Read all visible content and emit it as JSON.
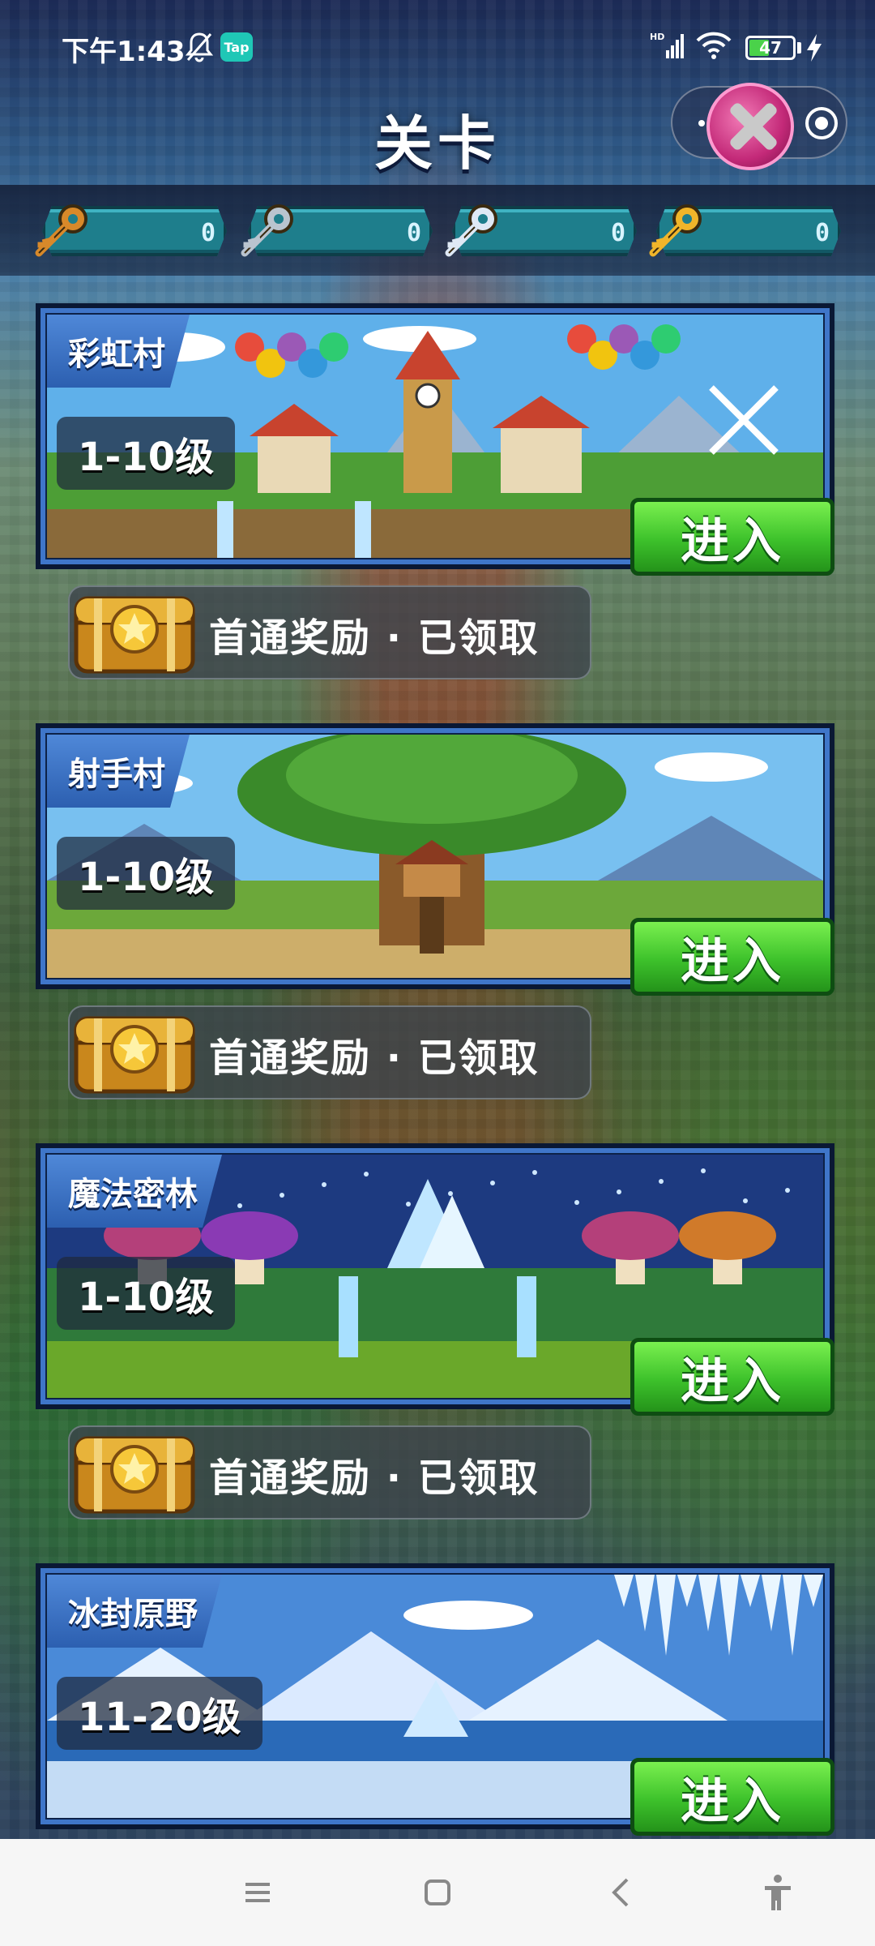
{
  "status": {
    "time": "下午1:43",
    "tap_badge": "Tap",
    "battery": "47",
    "battery_level": 0.47
  },
  "header": {
    "title": "关卡"
  },
  "keys": [
    {
      "name": "bronze-key-icon",
      "color": "#d8892a",
      "count": "0"
    },
    {
      "name": "silver-key-icon",
      "color": "#b9c4cf",
      "count": "0"
    },
    {
      "name": "crystal-key-icon",
      "color": "#dfe9f5",
      "count": "0"
    },
    {
      "name": "gold-key-icon",
      "color": "#f0b52a",
      "count": "0"
    }
  ],
  "levels": [
    {
      "name": "彩虹村",
      "range": "1-10级",
      "enter": "进入",
      "reward": "首通奖励 · 已领取"
    },
    {
      "name": "射手村",
      "range": "1-10级",
      "enter": "进入",
      "reward": "首通奖励 · 已领取"
    },
    {
      "name": "魔法密林",
      "range": "1-10级",
      "enter": "进入",
      "reward": "首通奖励 · 已领取"
    },
    {
      "name": "冰封原野",
      "range": "11-20级",
      "enter": "进入"
    }
  ]
}
